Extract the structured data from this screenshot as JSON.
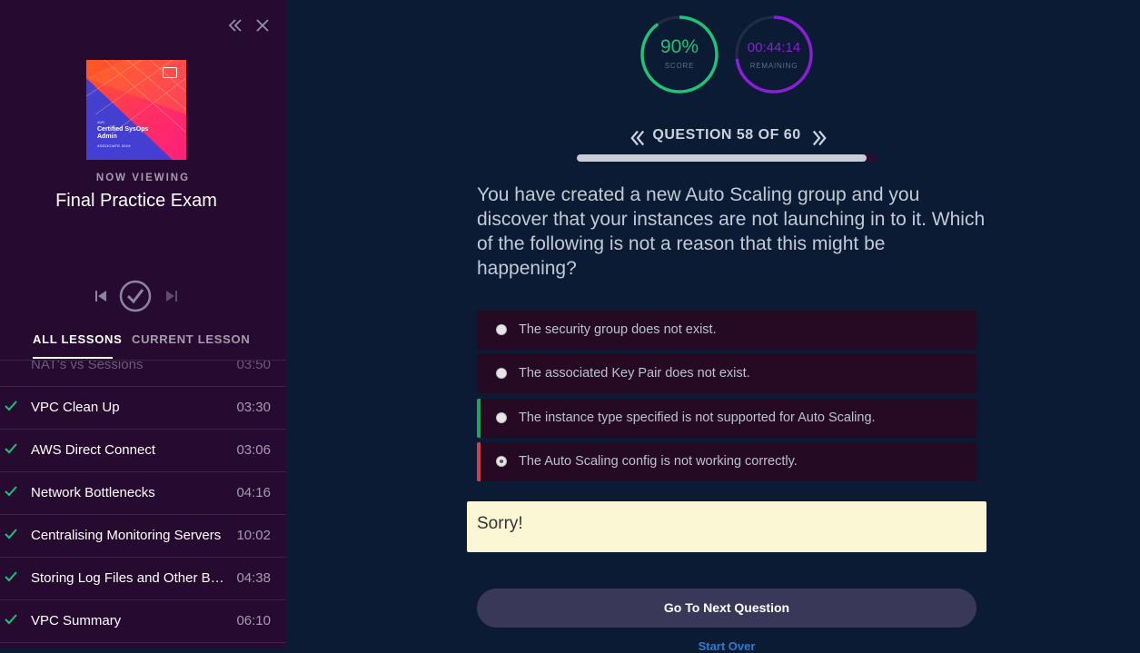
{
  "sidebar": {
    "cover": {
      "line1": "AWS",
      "title": "Certified SysOps Admin",
      "subtitle": "ASSOCIATE 2019"
    },
    "now_viewing_label": "NOW VIEWING",
    "lesson_title": "Final Practice Exam",
    "tabs": {
      "all_lessons": "ALL LESSONS",
      "current_lesson": "CURRENT LESSON"
    },
    "partial_lesson": {
      "name": "NAT's vs Sessions",
      "time": "03:50"
    },
    "lessons": [
      {
        "name": "VPC Clean Up",
        "time": "03:30"
      },
      {
        "name": "AWS Direct Connect",
        "time": "03:06"
      },
      {
        "name": "Network Bottlenecks",
        "time": "04:16"
      },
      {
        "name": "Centralising Monitoring Servers",
        "time": "10:02"
      },
      {
        "name": "Storing Log Files and Other Ba...",
        "time": "04:38"
      },
      {
        "name": "VPC Summary",
        "time": "06:10"
      }
    ]
  },
  "score": {
    "value": "90%",
    "label": "SCORE",
    "fraction": 0.9,
    "color": "#1fc378"
  },
  "timer": {
    "value": "00:44:14",
    "label": "REMAINING",
    "fraction": 0.73,
    "color": "#8a1fd6"
  },
  "question": {
    "counter": "QUESTION 58 OF 60",
    "progress": 0.967,
    "text": "You have created a new Auto Scaling group and you discover that your instances are not launching in to it. Which of the following is not a reason that this might be happening?",
    "options": [
      {
        "text": "The security group does not exist.",
        "state": "none"
      },
      {
        "text": "The associated Key Pair does not exist.",
        "state": "none"
      },
      {
        "text": "The instance type specified is not supported for Auto Scaling.",
        "state": "correct"
      },
      {
        "text": "The Auto Scaling config is not working correctly.",
        "state": "wrong-selected"
      }
    ]
  },
  "feedback": "Sorry!",
  "next_button": "Go To Next Question",
  "start_over": "Start Over",
  "colors": {
    "correct": "#1fa55b",
    "wrong": "#d23f4f"
  }
}
